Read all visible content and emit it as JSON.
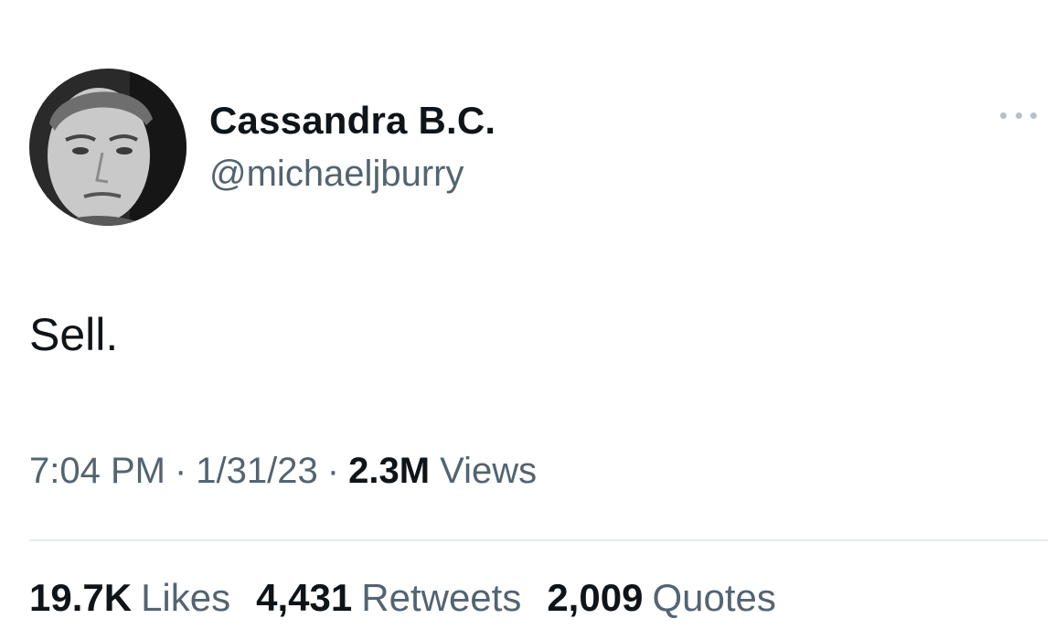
{
  "author": {
    "display_name": "Cassandra B.C.",
    "handle": "@michaeljburry",
    "avatar_icon": "profile-photo"
  },
  "more_icon": "more-dots-icon",
  "tweet": {
    "text": "Sell."
  },
  "meta": {
    "time": "7:04 PM",
    "separator": "·",
    "date": "1/31/23",
    "views_count": "2.3M",
    "views_label": "Views"
  },
  "stats": [
    {
      "count": "19.7K",
      "label": "Likes"
    },
    {
      "count": "4,431",
      "label": "Retweets"
    },
    {
      "count": "2,009",
      "label": "Quotes"
    }
  ],
  "colors": {
    "text_primary": "#0f1419",
    "text_secondary": "#536471",
    "divider": "#e7ebee"
  }
}
